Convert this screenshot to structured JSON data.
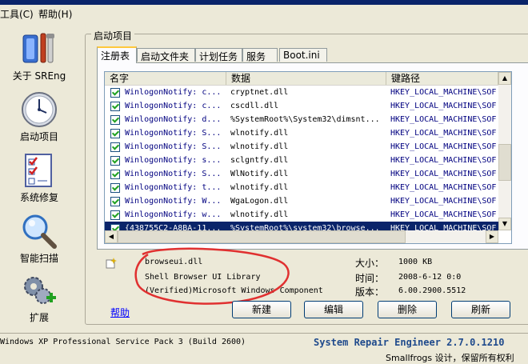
{
  "menu": {
    "items": [
      "工具(C)",
      "帮助(H)"
    ]
  },
  "sidebar": {
    "items": [
      {
        "label": "关于 SREng",
        "icon": "tools-icon"
      },
      {
        "label": "启动项目",
        "icon": "clock-icon"
      },
      {
        "label": "系统修复",
        "icon": "checklist-icon"
      },
      {
        "label": "智能扫描",
        "icon": "magnifier-icon"
      },
      {
        "label": "扩展",
        "icon": "gears-plus-icon"
      }
    ]
  },
  "group": {
    "title": "启动项目"
  },
  "tabs": [
    "注册表",
    "启动文件夹",
    "计划任务",
    "服务",
    "Boot.ini"
  ],
  "list": {
    "columns": [
      "名字",
      "数据",
      "键路径"
    ],
    "rows": [
      {
        "name": "WinlogonNotify: c...",
        "data": "cryptnet.dll",
        "key": "HKEY_LOCAL_MACHINE\\SOF",
        "selected": false
      },
      {
        "name": "WinlogonNotify: c...",
        "data": "cscdll.dll",
        "key": "HKEY_LOCAL_MACHINE\\SOF",
        "selected": false
      },
      {
        "name": "WinlogonNotify: d...",
        "data": "%SystemRoot%\\System32\\dimsnt...",
        "key": "HKEY_LOCAL_MACHINE\\SOF",
        "selected": false
      },
      {
        "name": "WinlogonNotify: S...",
        "data": "wlnotify.dll",
        "key": "HKEY_LOCAL_MACHINE\\SOF",
        "selected": false
      },
      {
        "name": "WinlogonNotify: S...",
        "data": "wlnotify.dll",
        "key": "HKEY_LOCAL_MACHINE\\SOF",
        "selected": false
      },
      {
        "name": "WinlogonNotify: s...",
        "data": "sclgntfy.dll",
        "key": "HKEY_LOCAL_MACHINE\\SOF",
        "selected": false
      },
      {
        "name": "WinlogonNotify: S...",
        "data": "WlNotify.dll",
        "key": "HKEY_LOCAL_MACHINE\\SOF",
        "selected": false
      },
      {
        "name": "WinlogonNotify: t...",
        "data": "wlnotify.dll",
        "key": "HKEY_LOCAL_MACHINE\\SOF",
        "selected": false
      },
      {
        "name": "WinlogonNotify: W...",
        "data": "WgaLogon.dll",
        "key": "HKEY_LOCAL_MACHINE\\SOF",
        "selected": false
      },
      {
        "name": "WinlogonNotify: w...",
        "data": "wlnotify.dll",
        "key": "HKEY_LOCAL_MACHINE\\SOF",
        "selected": false
      },
      {
        "name": "{438755C2-A8BA-11...",
        "data": "%SystemRoot%\\system32\\browse...",
        "key": "HKEY_LOCAL_MACHINE\\SOF",
        "selected": true
      }
    ]
  },
  "details": {
    "file": "browseui.dll",
    "description": "Shell Browser UI Library",
    "company": "(Verified)Microsoft Windows Component",
    "size_label": "大小：",
    "size_value": "1000 KB",
    "time_label": "时间：",
    "time_value": "2008-6-12 0:0",
    "version_label": "版本：",
    "version_value": "6.00.2900.5512"
  },
  "buttons": {
    "help": "帮助",
    "new": "新建",
    "edit": "编辑",
    "delete": "删除",
    "refresh": "刷新"
  },
  "status": {
    "os": "Windows XP Professional Service Pack 3 (Build 2600)",
    "product": "System Repair Engineer 2.7.0.1210",
    "credit": "Smallfrogs 设计，保留所有权利"
  },
  "colors": {
    "selection": "#0a246a",
    "annotation": "#e03030",
    "product_text": "#1f4a8c"
  }
}
